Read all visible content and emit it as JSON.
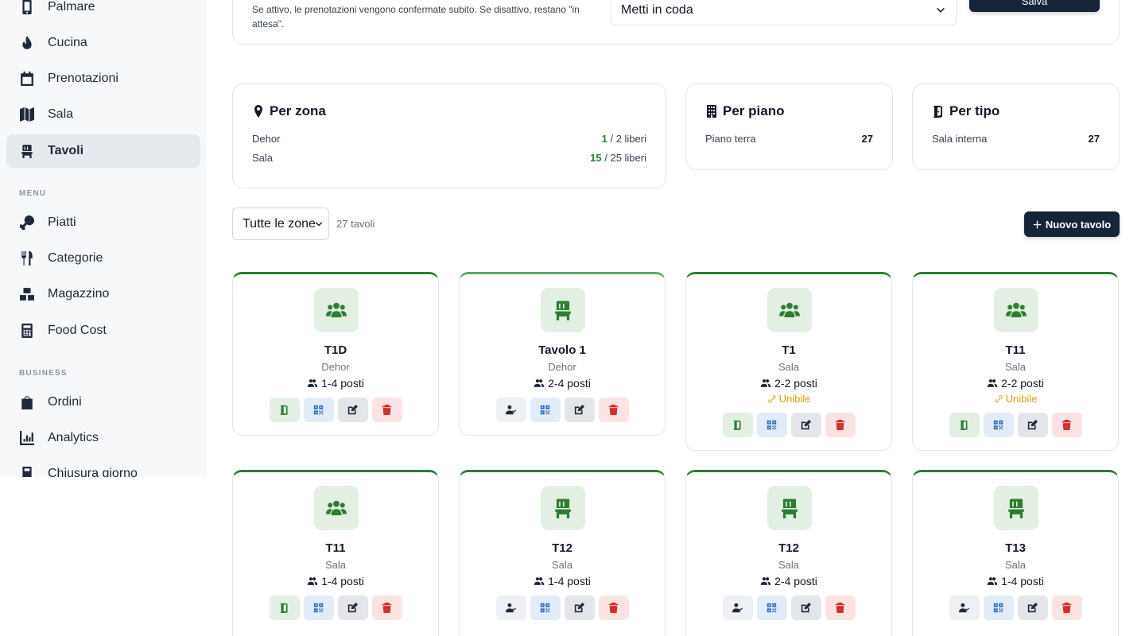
{
  "sidebar": {
    "items_top": [
      {
        "label": "Palmare",
        "icon": "mobile-icon"
      },
      {
        "label": "Cucina",
        "icon": "fire-icon"
      },
      {
        "label": "Prenotazioni",
        "icon": "calendar-icon"
      },
      {
        "label": "Sala",
        "icon": "map-icon"
      },
      {
        "label": "Tavoli",
        "icon": "chair-icon",
        "active": true
      }
    ],
    "section_menu": "MENU",
    "items_menu": [
      {
        "label": "Piatti",
        "icon": "drumstick-icon"
      },
      {
        "label": "Categorie",
        "icon": "utensils-icon"
      },
      {
        "label": "Magazzino",
        "icon": "boxes-icon"
      },
      {
        "label": "Food Cost",
        "icon": "calculator-icon"
      }
    ],
    "section_business": "BUSINESS",
    "items_business": [
      {
        "label": "Ordini",
        "icon": "bag-icon"
      },
      {
        "label": "Analytics",
        "icon": "chart-icon"
      },
      {
        "label": "Chiusura giorno",
        "icon": "register-icon"
      }
    ]
  },
  "settings": {
    "description": "Se attivo, le prenotazioni vengono confermate subito. Se disattivo, restano \"in attesa\".",
    "select_value": "Metti in coda",
    "save_label": "Salva"
  },
  "stats": {
    "zona": {
      "title": "Per zona",
      "rows": [
        {
          "label": "Dehor",
          "free": "1",
          "total": " / 2 liberi"
        },
        {
          "label": "Sala",
          "free": "15",
          "total": " / 25 liberi"
        }
      ]
    },
    "piano": {
      "title": "Per piano",
      "rows": [
        {
          "label": "Piano terra",
          "value": "27"
        }
      ]
    },
    "tipo": {
      "title": "Per tipo",
      "rows": [
        {
          "label": "Sala interna",
          "value": "27"
        }
      ]
    }
  },
  "filter": {
    "zone_select": "Tutte le zone",
    "count": "27 tavoli",
    "new_button": "Nuovo tavolo"
  },
  "tables": [
    {
      "name": "T1D",
      "zone": "Dehor",
      "seats": "1-4 posti",
      "icon": "group-icon",
      "merge": "",
      "first_action": "green"
    },
    {
      "name": "Tavolo 1",
      "zone": "Dehor",
      "seats": "2-4 posti",
      "icon": "chair-icon",
      "merge": "",
      "first_action": "slate"
    },
    {
      "name": "T1",
      "zone": "Sala",
      "seats": "2-2 posti",
      "icon": "group-icon",
      "merge": "Unibile",
      "first_action": "green"
    },
    {
      "name": "T11",
      "zone": "Sala",
      "seats": "2-2 posti",
      "icon": "group-icon",
      "merge": "Unibile",
      "first_action": "green"
    },
    {
      "name": "T11",
      "zone": "Sala",
      "seats": "1-4 posti",
      "icon": "group-icon",
      "merge": "",
      "first_action": "green"
    },
    {
      "name": "T12",
      "zone": "Sala",
      "seats": "1-4 posti",
      "icon": "chair-icon",
      "merge": "",
      "first_action": "slate"
    },
    {
      "name": "T12",
      "zone": "Sala",
      "seats": "2-4 posti",
      "icon": "chair-icon",
      "merge": "",
      "first_action": "slate"
    },
    {
      "name": "T13",
      "zone": "Sala",
      "seats": "1-4 posti",
      "icon": "chair-icon",
      "merge": "",
      "first_action": "slate"
    }
  ]
}
